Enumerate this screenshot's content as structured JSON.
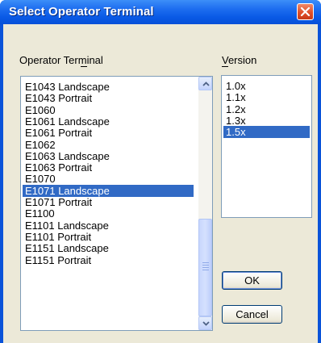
{
  "window": {
    "title": "Select Operator Terminal"
  },
  "terminal_list": {
    "label": "Operator Terminal",
    "items": [
      "E1043 Landscape",
      "E1043 Portrait",
      "E1060",
      "E1061 Landscape",
      "E1061 Portrait",
      "E1062",
      "E1063 Landscape",
      "E1063 Portrait",
      "E1070",
      "E1071 Landscape",
      "E1071 Portrait",
      "E1100",
      "E1101 Landscape",
      "E1101 Portrait",
      "E1151 Landscape",
      "E1151 Portrait"
    ],
    "selected": "E1071 Landscape"
  },
  "version_list": {
    "label": "Version",
    "items": [
      "1.0x",
      "1.1x",
      "1.2x",
      "1.3x",
      "1.5x"
    ],
    "selected": "1.5x"
  },
  "buttons": {
    "ok": "OK",
    "cancel": "Cancel"
  },
  "colors": {
    "selection": "#316ac5",
    "titlebar": "#0a5ae6"
  }
}
